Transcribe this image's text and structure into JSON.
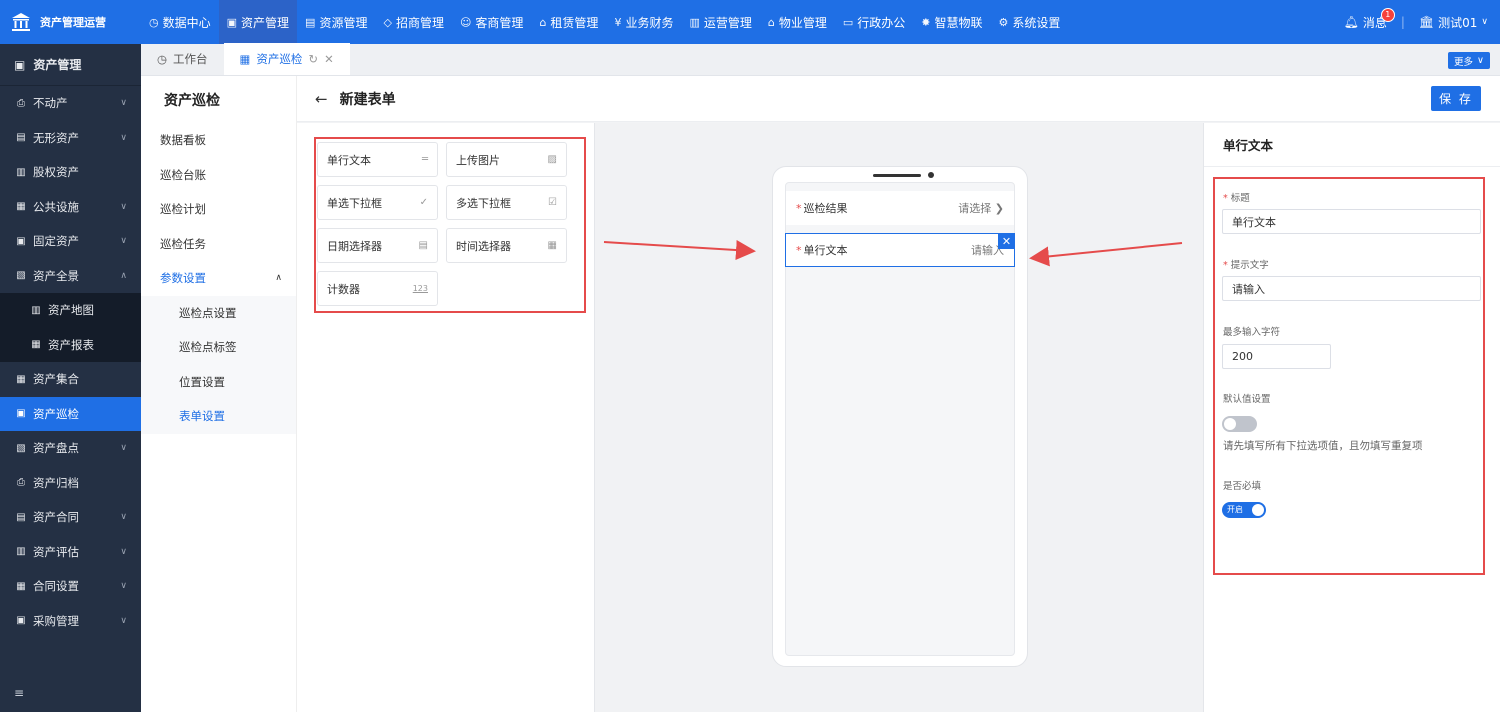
{
  "top_nav": {
    "app_title": "资产管理运营",
    "items": [
      {
        "label": "数据中心",
        "icon": "dashboard-icon"
      },
      {
        "label": "资产管理",
        "icon": "cube-icon",
        "active": true
      },
      {
        "label": "资源管理",
        "icon": "building-icon"
      },
      {
        "label": "招商管理",
        "icon": "tag-icon"
      },
      {
        "label": "客商管理",
        "icon": "users-icon"
      },
      {
        "label": "租赁管理",
        "icon": "house-icon"
      },
      {
        "label": "业务财务",
        "icon": "yen-icon"
      },
      {
        "label": "运营管理",
        "icon": "chart-icon"
      },
      {
        "label": "物业管理",
        "icon": "property-icon"
      },
      {
        "label": "行政办公",
        "icon": "monitor-icon"
      },
      {
        "label": "智慧物联",
        "icon": "iot-icon"
      },
      {
        "label": "系统设置",
        "icon": "gear-icon"
      }
    ],
    "messages_label": "消息",
    "messages_count": "1",
    "user_label": "测试01"
  },
  "sidebar": {
    "header": "资产管理",
    "items": [
      {
        "label": "不动产",
        "expandable": true
      },
      {
        "label": "无形资产",
        "expandable": true
      },
      {
        "label": "股权资产",
        "expandable": false
      },
      {
        "label": "公共设施",
        "expandable": true
      },
      {
        "label": "固定资产",
        "expandable": true
      },
      {
        "label": "资产全景",
        "expandable": true,
        "expanded": true
      }
    ],
    "sub_items": [
      {
        "label": "资产地图"
      },
      {
        "label": "资产报表"
      }
    ],
    "items_after": [
      {
        "label": "资产集合",
        "expandable": false
      },
      {
        "label": "资产巡检",
        "expandable": false,
        "active": true
      },
      {
        "label": "资产盘点",
        "expandable": true
      },
      {
        "label": "资产归档",
        "expandable": false
      },
      {
        "label": "资产合同",
        "expandable": true
      },
      {
        "label": "资产评估",
        "expandable": true
      },
      {
        "label": "合同设置",
        "expandable": true
      },
      {
        "label": "采购管理",
        "expandable": true
      }
    ]
  },
  "tabs": {
    "items": [
      {
        "label": "工作台",
        "active": false
      },
      {
        "label": "资产巡检",
        "active": true
      }
    ],
    "more_label": "更多"
  },
  "submenu": {
    "title": "资产巡检",
    "items": [
      {
        "label": "数据看板"
      },
      {
        "label": "巡检台账"
      },
      {
        "label": "巡检计划"
      },
      {
        "label": "巡检任务"
      }
    ],
    "group": {
      "label": "参数设置"
    },
    "group_items": [
      {
        "label": "巡检点设置"
      },
      {
        "label": "巡检点标签"
      },
      {
        "label": "位置设置"
      },
      {
        "label": "表单设置",
        "active": true
      }
    ]
  },
  "page": {
    "title": "新建表单",
    "save_label": "保 存"
  },
  "palette": {
    "components": [
      {
        "label": "单行文本",
        "icon": "text-line-icon"
      },
      {
        "label": "上传图片",
        "icon": "image-icon"
      },
      {
        "label": "单选下拉框",
        "icon": "radio-check-icon"
      },
      {
        "label": "多选下拉框",
        "icon": "multi-check-icon"
      },
      {
        "label": "日期选择器",
        "icon": "date-icon"
      },
      {
        "label": "时间选择器",
        "icon": "calendar-icon"
      },
      {
        "label": "计数器",
        "icon": "counter-icon"
      }
    ]
  },
  "preview": {
    "fields": [
      {
        "label": "巡检结果",
        "placeholder": "请选择",
        "required": true
      },
      {
        "label": "单行文本",
        "placeholder": "请输入",
        "required": true,
        "selected": true
      }
    ]
  },
  "properties": {
    "title": "单行文本",
    "title_label": "标题",
    "title_value": "单行文本",
    "hint_label": "提示文字",
    "hint_value": "请输入",
    "max_label": "最多输入字符",
    "max_value": "200",
    "default_label": "默认值设置",
    "default_on": false,
    "default_hint": "请先填写所有下拉选项值，且勿填写重复项",
    "required_label": "是否必填",
    "required_on": true,
    "required_toggle_text": "开启"
  },
  "colors": {
    "brand": "#1f6fe5",
    "sidebar": "#243044",
    "annotation": "#e54b4b"
  }
}
